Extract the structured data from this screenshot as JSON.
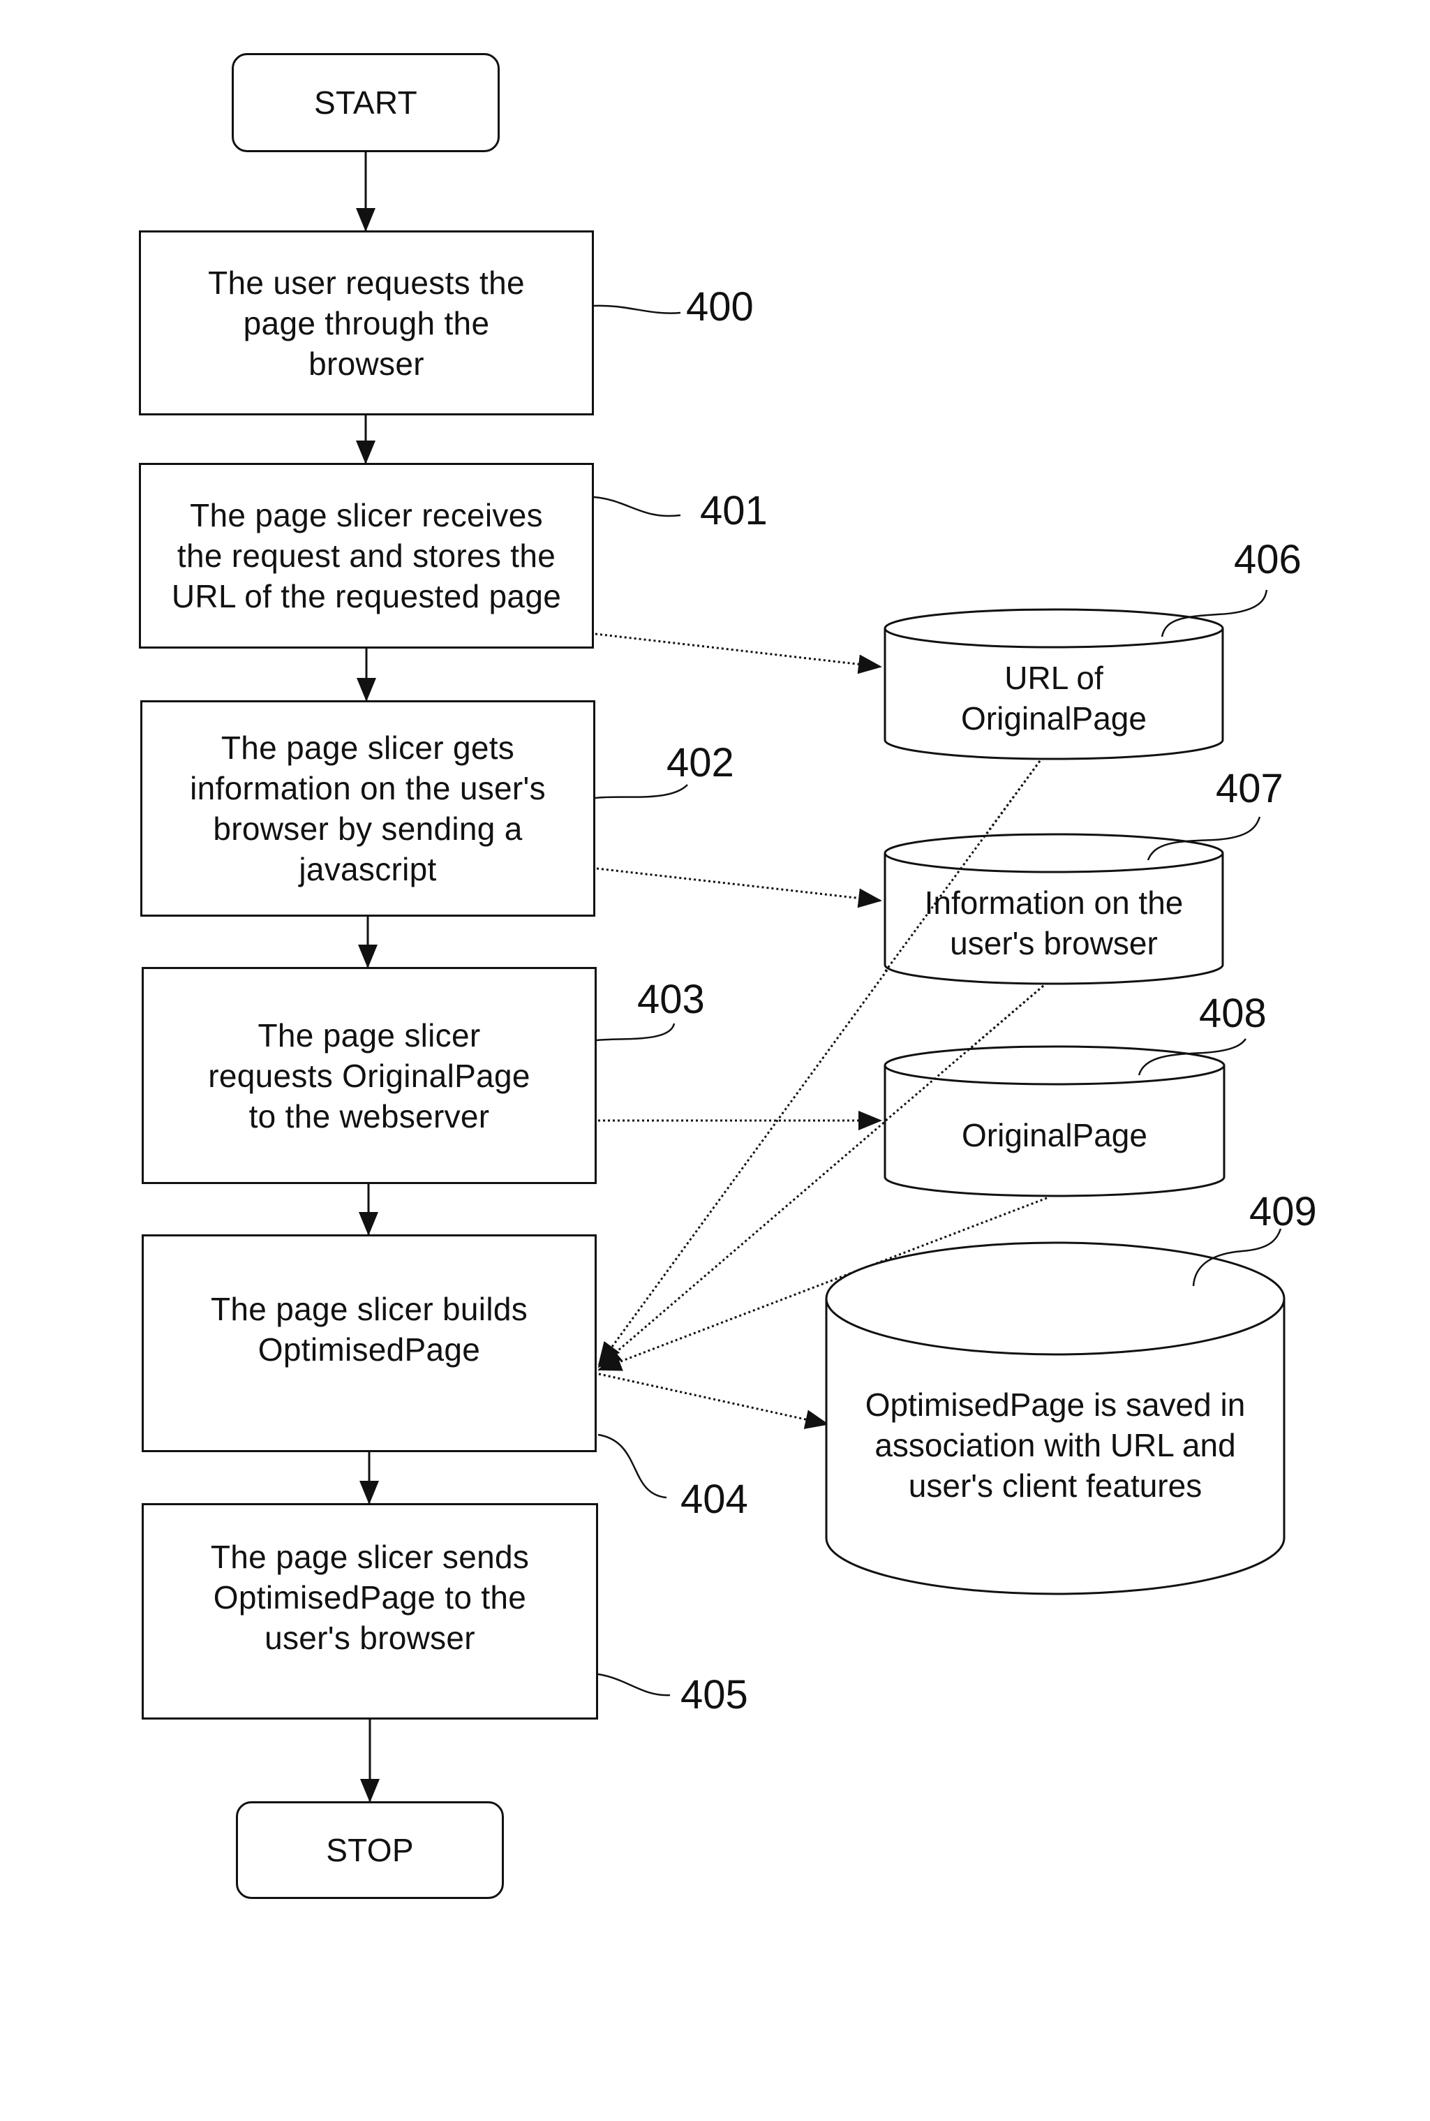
{
  "figure": {
    "type": "flowchart",
    "terminals": {
      "start": "START",
      "stop": "STOP"
    },
    "steps": [
      {
        "ref": "400",
        "text": "The user requests the\npage through the\nbrowser"
      },
      {
        "ref": "401",
        "text": "The page slicer receives\nthe request and stores the\nURL of the requested page"
      },
      {
        "ref": "402",
        "text": "The page slicer gets\ninformation on the user's\nbrowser by sending a\njavascript"
      },
      {
        "ref": "403",
        "text": "The page slicer\nrequests OriginalPage\nto the webserver"
      },
      {
        "ref": "404",
        "text": "The page slicer builds\nOptimisedPage"
      },
      {
        "ref": "405",
        "text": "The page slicer sends\nOptimisedPage to the\nuser's browser"
      }
    ],
    "stores": [
      {
        "ref": "406",
        "text": "URL of\nOriginalPage"
      },
      {
        "ref": "407",
        "text": "Information on the\nuser's browser"
      },
      {
        "ref": "408",
        "text": "OriginalPage"
      },
      {
        "ref": "409",
        "text": "OptimisedPage is saved in\nassociation with URL and\nuser's client features"
      }
    ],
    "connections": [
      {
        "from": "start",
        "to": "400",
        "style": "solid"
      },
      {
        "from": "400",
        "to": "401",
        "style": "solid"
      },
      {
        "from": "401",
        "to": "402",
        "style": "solid"
      },
      {
        "from": "402",
        "to": "403",
        "style": "solid"
      },
      {
        "from": "403",
        "to": "404",
        "style": "solid"
      },
      {
        "from": "404",
        "to": "405",
        "style": "solid"
      },
      {
        "from": "405",
        "to": "stop",
        "style": "solid"
      },
      {
        "from": "401",
        "to": "406",
        "style": "dotted"
      },
      {
        "from": "402",
        "to": "407",
        "style": "dotted"
      },
      {
        "from": "403",
        "to": "408",
        "style": "dotted"
      },
      {
        "from": "406",
        "to": "404",
        "style": "dotted"
      },
      {
        "from": "407",
        "to": "404",
        "style": "dotted"
      },
      {
        "from": "408",
        "to": "404",
        "style": "dotted"
      },
      {
        "from": "404",
        "to": "409",
        "style": "dotted"
      }
    ],
    "colors": {
      "ink": "#111111",
      "background": "#ffffff"
    }
  }
}
